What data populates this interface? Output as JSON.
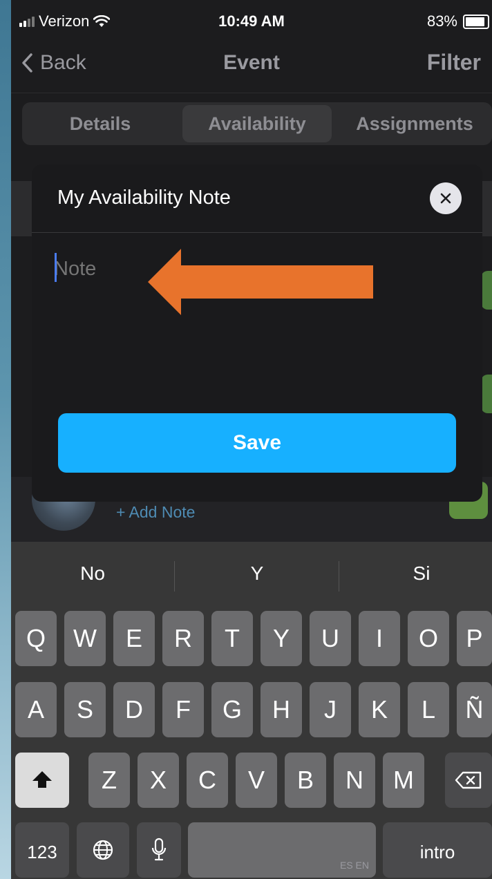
{
  "status_bar": {
    "carrier": "Verizon",
    "time": "10:49 AM",
    "battery": "83%"
  },
  "nav": {
    "back_label": "Back",
    "title": "Event",
    "filter_label": "Filter"
  },
  "tabs": [
    {
      "label": "Details"
    },
    {
      "label": "Availability",
      "active": true
    },
    {
      "label": "Assignments"
    }
  ],
  "background": {
    "add_note_label": "+ Add Note"
  },
  "modal": {
    "title": "My Availability Note",
    "note_placeholder": "Note",
    "note_value": "",
    "save_label": "Save"
  },
  "keyboard": {
    "suggestions": [
      "No",
      "Y",
      "Si"
    ],
    "row1": [
      "Q",
      "W",
      "E",
      "R",
      "T",
      "Y",
      "U",
      "I",
      "O",
      "P"
    ],
    "row2": [
      "A",
      "S",
      "D",
      "F",
      "G",
      "H",
      "J",
      "K",
      "L",
      "Ñ"
    ],
    "row3": [
      "Z",
      "X",
      "C",
      "V",
      "B",
      "N",
      "M"
    ],
    "numbers_label": "123",
    "space_hint": "ES EN",
    "return_label": "intro"
  },
  "colors": {
    "accent": "#17b0ff",
    "annotation_arrow": "#e8732c",
    "link": "#4e8bb3"
  }
}
